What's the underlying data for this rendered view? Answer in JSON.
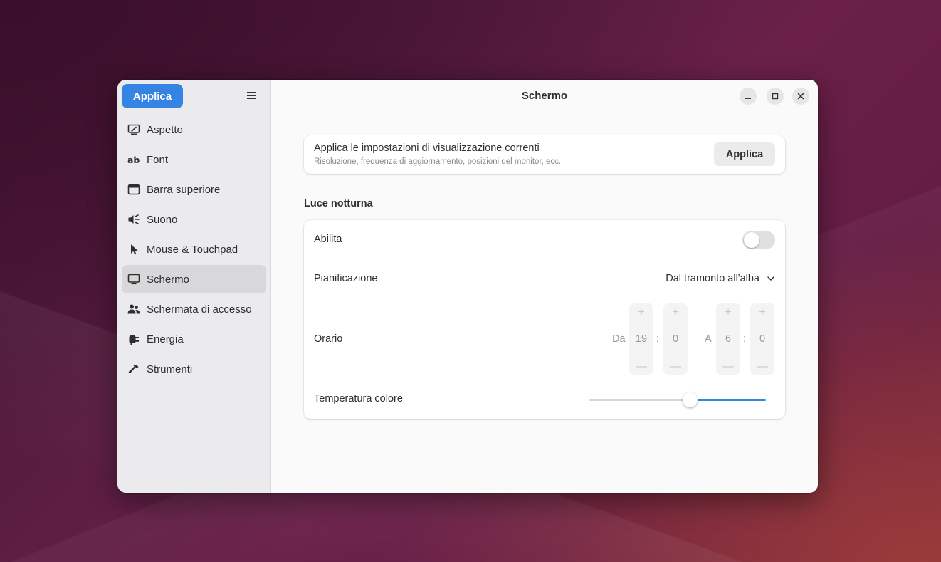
{
  "window": {
    "title": "Schermo"
  },
  "sidebar": {
    "apply_label": "Applica",
    "items": [
      {
        "label": "Aspetto",
        "icon": "appearance-icon"
      },
      {
        "label": "Font",
        "icon": "font-icon"
      },
      {
        "label": "Barra superiore",
        "icon": "top-bar-icon"
      },
      {
        "label": "Suono",
        "icon": "sound-icon"
      },
      {
        "label": "Mouse & Touchpad",
        "icon": "pointer-icon"
      },
      {
        "label": "Schermo",
        "icon": "display-icon",
        "active": true
      },
      {
        "label": "Schermata di accesso",
        "icon": "users-icon"
      },
      {
        "label": "Energia",
        "icon": "power-plug-icon"
      },
      {
        "label": "Strumenti",
        "icon": "hammer-icon"
      }
    ]
  },
  "apply_card": {
    "title": "Applica le impostazioni di visualizzazione correnti",
    "subtitle": "Risoluzione, frequenza di aggiornamento, posizioni del monitor, ecc.",
    "button_label": "Applica"
  },
  "night_light": {
    "section_title": "Luce notturna",
    "enable": {
      "label": "Abilita",
      "value": false
    },
    "schedule": {
      "label": "Pianificazione",
      "value": "Dal tramonto all'alba"
    },
    "time": {
      "label": "Orario",
      "from_label": "Da",
      "from_hour": "19",
      "from_minute": "0",
      "to_label": "A",
      "to_hour": "6",
      "to_minute": "0",
      "separator": ":",
      "plus": "+",
      "minus": "—"
    },
    "temperature": {
      "label": "Temperatura colore",
      "value_fraction": 0.57
    }
  },
  "colors": {
    "accent": "#3584e4",
    "sidebar_bg": "#ebebed",
    "content_bg": "#fafafa"
  }
}
